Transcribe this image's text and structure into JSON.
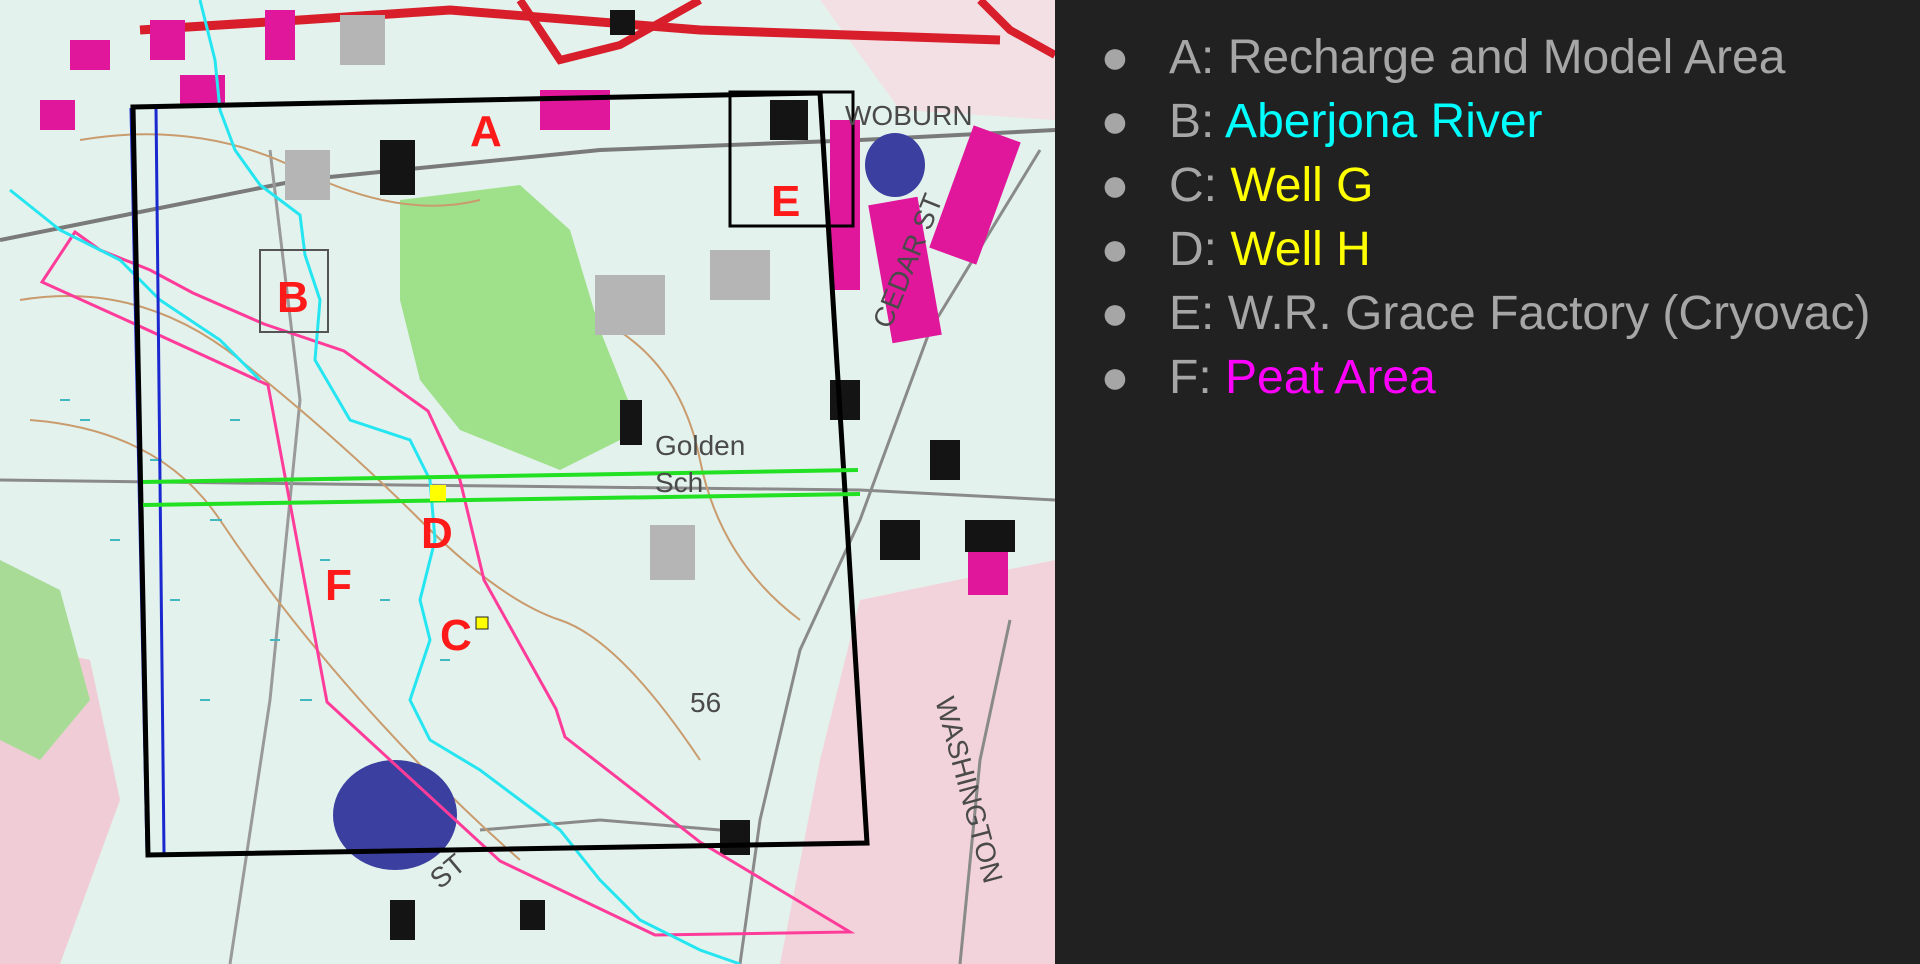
{
  "map": {
    "labels": {
      "a": "A",
      "b": "B",
      "c": "C",
      "d": "D",
      "e": "E",
      "f": "F"
    },
    "place_text": {
      "woburn": "WOBURN",
      "golden": "Golden",
      "sch": "Sch",
      "cedar": "CEDAR ST",
      "washington": "WASHINGTON",
      "st": "ST",
      "elev": "56"
    },
    "colors": {
      "label": "#ff1a1a",
      "model_area": "#000000",
      "river": "#25e6f0",
      "peat": "#ff3c9a",
      "wells": "#ffff00",
      "transect": "#22e022",
      "boundary": "#1a28d0",
      "factory_box": "#000000"
    }
  },
  "legend": {
    "items": [
      {
        "prefix": "A: ",
        "name": "Recharge and Model Area",
        "name_color": "#a6a6a6"
      },
      {
        "prefix": "B: ",
        "name": "Aberjona River",
        "name_color": "#00ffff"
      },
      {
        "prefix": "C: ",
        "name": "Well G",
        "name_color": "#ffff00"
      },
      {
        "prefix": "D: ",
        "name": "Well H",
        "name_color": "#ffff00"
      },
      {
        "prefix": "E: ",
        "name": "W.R. Grace Factory (Cryovac)",
        "name_color": "#a6a6a6"
      },
      {
        "prefix": "F: ",
        "name": "Peat Area",
        "name_color": "#ff00ff"
      }
    ],
    "bullet": "●"
  }
}
